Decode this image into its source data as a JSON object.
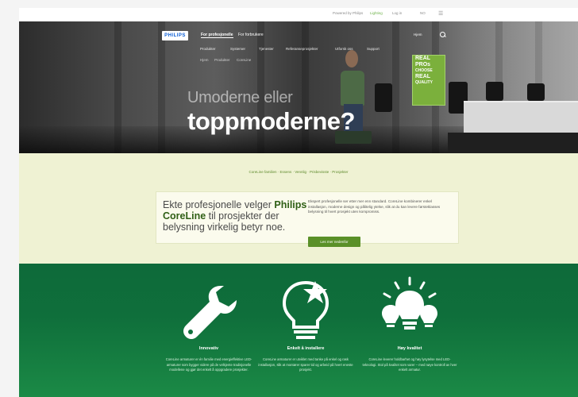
{
  "utility_bar": {
    "left_text": "Powered by Philips",
    "lighting_label": "Lighting",
    "user_label": "Log in",
    "lang_label": "NO",
    "menu_icon": "hamburger-icon"
  },
  "header": {
    "logo_text": "PHILIPS",
    "tabs": [
      {
        "label": "For profesjonelle",
        "active": true
      },
      {
        "label": "For forbrukere",
        "active": false
      }
    ],
    "right_items": [
      "Hjem"
    ],
    "search_icon": "search-icon",
    "nav": [
      "Produkter",
      "Systemer",
      "Tjenester",
      "Referanseprosjekter",
      "Utforsk oss",
      "Support"
    ],
    "subnav": [
      "Hjem",
      "Produkter",
      "CoreLine"
    ]
  },
  "hero": {
    "line1": "Umoderne eller",
    "line2": "toppmoderne?",
    "badge_lines": [
      "REAL",
      "PROs",
      "CHOOSE",
      "REAL",
      "QUALITY"
    ]
  },
  "middle": {
    "breadcrumb": "CoreLine familien · Essens · Vennlig · Prisbevisste · Prosjekter",
    "headline_pre": "Ekte profesjonelle velger",
    "headline_brand": "Philips CoreLine",
    "headline_post": "til prosjekter der belysning virkelig betyr noe.",
    "body": "Ekspert profesjonelle ser etter mer enn standard. CoreLine kombinerer enkel installasjon, moderne design og pålitelig ytelse, slik at du kan levere førsteklasses belysning til hvert prosjekt uten kompromiss.",
    "cta": "Les mer nedenfor"
  },
  "features": [
    {
      "icon": "wrench-icon",
      "title": "Innovativ",
      "text": "CoreLine armaturer er én familie med energieffektive LED-armaturer som bygger videre på de velkjente tradisjonelle modellene og gjør det enkelt å oppgradere prosjekter."
    },
    {
      "icon": "lightbulb-star-icon",
      "title": "Enkelt å installere",
      "text": "CoreLine armaturer er utviklet med tanke på enkel og rask installasjon, slik at montører sparer tid og arbeid på hvert eneste prosjekt."
    },
    {
      "icon": "bulb-cluster-icon",
      "title": "Høy kvalitet",
      "text": "CoreLine leverer holdbarhet og høy lysytelse med LED-teknologi. Stol på kvalitet som varer – med nøye kontroll av hver enkelt armatur."
    }
  ],
  "colors": {
    "brand_blue": "#0b5ed7",
    "accent_green": "#5a9028",
    "feature_bg": "#0e6a3a",
    "mid_bg": "#eff2d3"
  }
}
